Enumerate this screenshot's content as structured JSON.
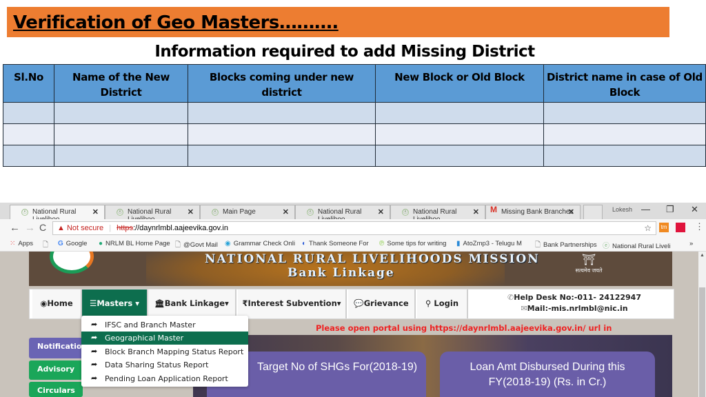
{
  "slide": {
    "banner_title": "Verification of Geo Masters……….",
    "subtitle": "Information required to add Missing District",
    "table": {
      "headers": [
        "Sl.No",
        "Name of the New District",
        "Blocks coming under new district",
        "New Block or Old Block",
        "District name in case of Old Block"
      ],
      "rows": [
        [
          "",
          "",
          "",
          "",
          ""
        ],
        [
          "",
          "",
          "",
          "",
          ""
        ],
        [
          "",
          "",
          "",
          "",
          ""
        ]
      ]
    },
    "colors": {
      "banner": "#ed7d31",
      "header": "#5b9bd5",
      "row_odd": "#cfdcec",
      "row_even": "#e9edf6"
    }
  },
  "browser": {
    "tabs": [
      {
        "title": "National Rural Livelihoo",
        "icon": "nrlm-favicon",
        "active": true
      },
      {
        "title": "National Rural Livelihoo",
        "icon": "nrlm-favicon",
        "active": false
      },
      {
        "title": "Main Page",
        "icon": "nrlm-favicon",
        "active": false
      },
      {
        "title": "National Rural Livelihoo",
        "icon": "nrlm-favicon",
        "active": false
      },
      {
        "title": "National Rural Livelihoo",
        "icon": "nrlm-favicon",
        "active": false
      },
      {
        "title": "Missing Bank Branches",
        "icon": "gmail-icon",
        "active": false
      }
    ],
    "close_glyph": "✕",
    "profile_label": "Lokesh",
    "window_controls": {
      "minimize": "—",
      "restore": "❐",
      "close": "✕"
    },
    "address": {
      "security_label": "Not secure",
      "scheme": "https",
      "url_rest": "://daynrlmbl.aajeevika.gov.in"
    },
    "bookmarks": [
      {
        "label": "Apps",
        "icon": "apps-grid-icon"
      },
      {
        "label": "",
        "icon": "page-icon"
      },
      {
        "label": "Google",
        "icon": "google-icon"
      },
      {
        "label": "NRLM BL Home Page",
        "icon": "nrlm-icon"
      },
      {
        "label": "@Govt Mail",
        "icon": "page-icon"
      },
      {
        "label": "Grammar Check Onli",
        "icon": "grammar-icon"
      },
      {
        "label": "Thank Someone For",
        "icon": "thank-icon"
      },
      {
        "label": "Some tips for writing",
        "icon": "tips-icon"
      },
      {
        "label": "AtoZmp3 - Telugu M",
        "icon": "atoz-icon"
      },
      {
        "label": "Bank Partnerships",
        "icon": "page-icon"
      },
      {
        "label": "National Rural Liveli",
        "icon": "nrlm-favicon"
      }
    ],
    "bookmarks_overflow": "»"
  },
  "site": {
    "header_line1": "NATIONAL RURAL LIVELIHOODS MISSION",
    "header_line2": "Bank Linkage",
    "emblem_caption": "सत्यमेव जयते",
    "menu": [
      {
        "label": "Home",
        "icon": "globe-icon",
        "glyph": "◉"
      },
      {
        "label": "Masters",
        "icon": "list-icon",
        "glyph": "☰",
        "caret": "▾",
        "active": true
      },
      {
        "label": "Bank Linkage",
        "icon": "bank-icon",
        "glyph": "🏛",
        "caret": "▾"
      },
      {
        "label": "Interest Subvention",
        "icon": "rupee-icon",
        "glyph": "₹",
        "caret": "▾"
      },
      {
        "label": "Grievance",
        "icon": "comment-icon",
        "glyph": "💬"
      },
      {
        "label": "Login",
        "icon": "key-icon",
        "glyph": "⚲"
      }
    ],
    "helpdesk": {
      "phone": "Help Desk No:-011- 24122947",
      "mail": "Mail:-mis.nrlmbl@nic.in"
    },
    "notice": "Please open portal using https://daynrlmbl.aajeevika.gov.in/ url in",
    "masters_dropdown": [
      {
        "label": "IFSC and Branch Master",
        "active": false
      },
      {
        "label": "Geographical Master",
        "active": true
      },
      {
        "label": "Block Branch Mapping Status Report",
        "active": false
      },
      {
        "label": "Data Sharing Status Report",
        "active": false
      },
      {
        "label": "Pending Loan Application Report",
        "active": false
      }
    ],
    "side_buttons": [
      {
        "label": "Notifications",
        "color": "#6a64b4"
      },
      {
        "label": "Advisory",
        "color": "#1aa659"
      },
      {
        "label": "Circulars",
        "color": "#1aa659"
      }
    ],
    "cards": [
      {
        "label": "Target No of SHGs For(2018-19)"
      },
      {
        "label": "Loan Amt Disbursed During this FY(2018-19) (Rs. in Cr.)"
      }
    ],
    "accent": "#0d6e4e"
  }
}
